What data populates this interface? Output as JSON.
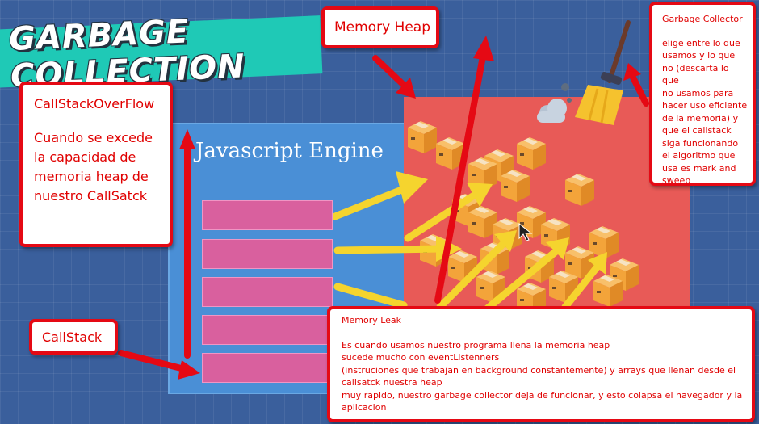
{
  "banner": {
    "title": "GARBAGE COLLECTION"
  },
  "engine": {
    "title": "Javascript Engine"
  },
  "cards": {
    "memory_heap": {
      "title": "Memory Heap"
    },
    "callstack_overflow": {
      "title": "CallStackOverFlow",
      "body": "Cuando se excede\nla capacidad de\nmemoria heap de\nnuestro CallSatck"
    },
    "callstack": {
      "title": "CallStack"
    },
    "garbage_collector": {
      "title": "Garbage Collector",
      "body": "elige entre lo que\nusamos y lo que\nno (descarta lo que\nno usamos para\nhacer uso eficiente\nde la memoria) y\nque el callstack\nsiga funcionando\nel algoritmo que\nusa es mark and\nsweep"
    },
    "memory_leak": {
      "title": "Memory Leak",
      "body": "Es cuando usamos nuestro programa llena la memoria heap\nsucede mucho con eventListenners\n(instruciones que trabajan en background constantemente) y arrays que llenan desde el\ncallsatck nuestra heap\nmuy rapido, nuestro garbage collector deja de funcionar, y esto colapsa el navegador y la\naplicacion"
    }
  },
  "colors": {
    "background": "#3a5f9c",
    "banner": "#1fc9b6",
    "engine": "#4a8fd6",
    "heap": "#e85a57",
    "stack_slot": "#d9609e",
    "annotation_border": "#e50914",
    "arrow": "#f5d42e",
    "box": "#f3a43a"
  },
  "icons": [
    "broom-icon",
    "cloud-icon",
    "cursor-icon"
  ]
}
